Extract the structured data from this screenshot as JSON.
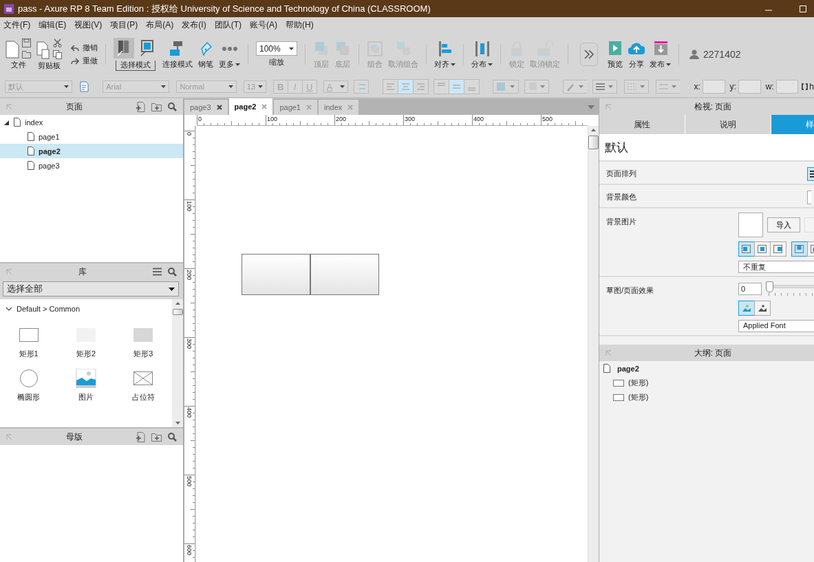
{
  "window": {
    "title": "pass - Axure RP 8 Team Edition : 授权给 University of Science and Technology of China (CLASSROOM)"
  },
  "menu": [
    "文件(F)",
    "编辑(E)",
    "视图(V)",
    "项目(P)",
    "布局(A)",
    "发布(I)",
    "团队(T)",
    "账号(A)",
    "帮助(H)"
  ],
  "toolbar": [
    {
      "kind": "file",
      "label": "文件"
    },
    {
      "kind": "clipboard",
      "label": "剪贴板"
    },
    {
      "kind": "history",
      "items": [
        {
          "kind": "undo",
          "label": "撤销"
        },
        {
          "kind": "redo",
          "label": "重做"
        }
      ]
    },
    {
      "kind": "separator"
    },
    {
      "kind": "mode",
      "label": "选择模式",
      "selected": true
    },
    {
      "kind": "connect",
      "label": "连接模式",
      "disabled": false,
      "dropdown": false
    },
    {
      "kind": "pen",
      "label": "钢笔",
      "disabled": false,
      "dropdown": false
    },
    {
      "kind": "more",
      "label": "更多",
      "disabled": false,
      "dropdown": true
    },
    {
      "kind": "separator"
    },
    {
      "kind": "zoom",
      "value": "100%",
      "label": "缩放"
    },
    {
      "kind": "separator"
    },
    {
      "kind": "top",
      "label": "顶层",
      "disabled": true,
      "dropdown": false
    },
    {
      "kind": "bottom",
      "label": "底层",
      "disabled": true,
      "dropdown": false
    },
    {
      "kind": "separator"
    },
    {
      "kind": "group",
      "label": "组合",
      "disabled": true,
      "dropdown": false
    },
    {
      "kind": "ungroup",
      "label": "取消组合",
      "disabled": true,
      "dropdown": false
    },
    {
      "kind": "separator"
    },
    {
      "kind": "align",
      "label": "对齐",
      "disabled": false,
      "dropdown": true
    },
    {
      "kind": "separator"
    },
    {
      "kind": "distribute",
      "label": "分布",
      "disabled": false,
      "dropdown": true
    },
    {
      "kind": "separator"
    },
    {
      "kind": "lock",
      "label": "锁定",
      "disabled": true,
      "dropdown": false
    },
    {
      "kind": "unlock",
      "label": "取消锁定",
      "disabled": true,
      "dropdown": false
    },
    {
      "kind": "separator"
    },
    {
      "kind": "expand"
    },
    {
      "kind": "preview",
      "label": "预览",
      "disabled": false,
      "dropdown": false
    },
    {
      "kind": "share",
      "label": "分享",
      "disabled": false,
      "dropdown": false
    },
    {
      "kind": "publish",
      "label": "发布",
      "disabled": false,
      "dropdown": true
    },
    {
      "kind": "separator"
    },
    {
      "kind": "user",
      "label": "2271402"
    }
  ],
  "format_bar": {
    "style": "默认",
    "font": "Arial",
    "weight": "Normal",
    "size": "13",
    "text_buttons": [
      "B",
      "I",
      "U"
    ],
    "font_color": "A",
    "h_align": [
      {
        "selected": false
      },
      {
        "selected": true
      },
      {
        "selected": false
      }
    ],
    "v_align": [
      {
        "selected": false
      },
      {
        "selected": true
      },
      {
        "selected": false
      }
    ],
    "fields": [
      {
        "label": "x:"
      },
      {
        "label": "y:"
      },
      {
        "label": "w:"
      }
    ],
    "h_label": "h"
  },
  "pages": {
    "title": "页面",
    "tree": [
      {
        "label": "index",
        "expanded": true,
        "selected": false,
        "children": [
          {
            "label": "page1",
            "selected": false
          },
          {
            "label": "page2",
            "selected": true
          },
          {
            "label": "page3",
            "selected": false
          }
        ]
      }
    ]
  },
  "library": {
    "title": "库",
    "filter": "选择全部",
    "section": "Default > Common",
    "items": [
      {
        "kind": "rect-outline",
        "label": "矩形1"
      },
      {
        "kind": "rect-light",
        "label": "矩形2"
      },
      {
        "kind": "rect-dark",
        "label": "矩形3"
      },
      {
        "kind": "ellipse",
        "label": "椭圆形"
      },
      {
        "kind": "image",
        "label": "图片"
      },
      {
        "kind": "placeholder",
        "label": "占位符"
      }
    ]
  },
  "masters": {
    "title": "母版"
  },
  "tabs": [
    {
      "label": "page3",
      "selected": false
    },
    {
      "label": "page2",
      "selected": true
    },
    {
      "label": "page1",
      "selected": false
    },
    {
      "label": "index",
      "selected": false
    }
  ],
  "ruler": {
    "x_labels": [
      "0",
      "100",
      "200",
      "300",
      "400",
      "500"
    ],
    "y_labels": [
      "0",
      "100",
      "200",
      "300",
      "400",
      "500",
      "600"
    ]
  },
  "canvas": {
    "widgets": [
      {
        "kind": "rectangle"
      },
      {
        "kind": "rectangle"
      }
    ]
  },
  "inspector": {
    "title": "检视: 页面",
    "tabs": [
      {
        "label": "属性",
        "selected": false
      },
      {
        "label": "说明",
        "selected": false
      },
      {
        "label": "样",
        "selected": true
      }
    ],
    "style_name": "默认",
    "rows": [
      {
        "kind": "arrange",
        "label": "页面排列"
      },
      {
        "kind": "color",
        "label": "背景颜色"
      },
      {
        "kind": "image",
        "label": "背景图片",
        "button": "导入",
        "align": [
          {
            "selected": true
          },
          {
            "selected": false
          },
          {
            "selected": false
          }
        ],
        "valign": [
          {
            "selected": true
          },
          {
            "selected": false
          }
        ],
        "repeat": "不重复"
      },
      {
        "kind": "sketch",
        "label": "草图/页面效果",
        "value": "0",
        "level": 0,
        "modes": [
          {
            "selected": true
          },
          {
            "selected": false
          }
        ],
        "font": "Applied Font"
      }
    ]
  },
  "outline": {
    "title": "大纲: 页面",
    "root": {
      "label": "page2",
      "children": [
        {
          "label": "(矩形)"
        },
        {
          "label": "(矩形)"
        }
      ]
    }
  }
}
